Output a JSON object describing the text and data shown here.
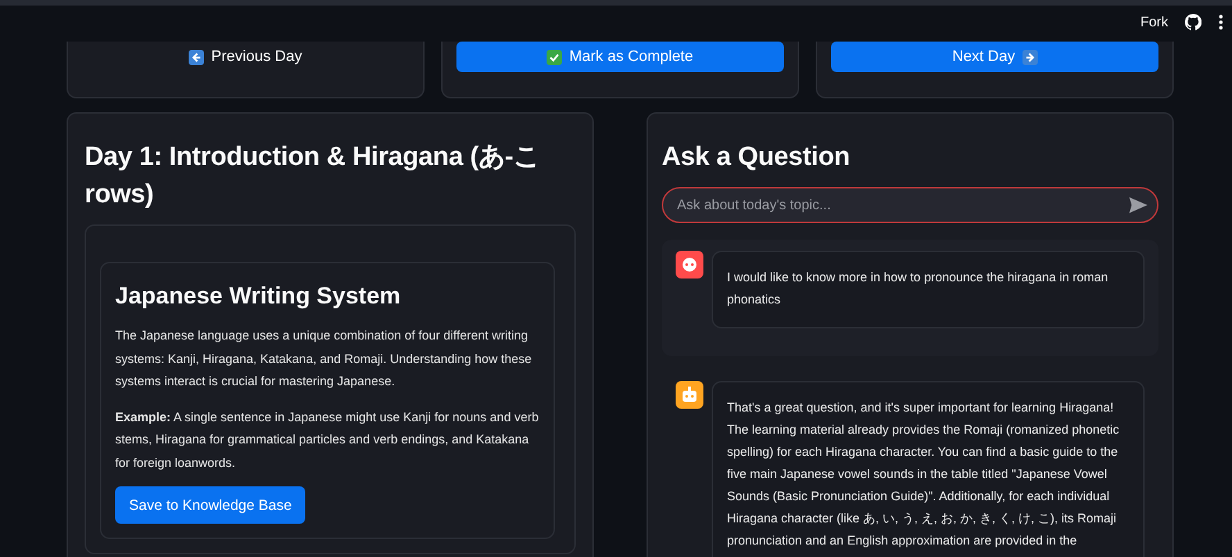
{
  "header": {
    "fork_label": "Fork"
  },
  "nav_buttons": [
    {
      "label": "Previous Day",
      "kind": "back",
      "primary": false
    },
    {
      "label": "Mark as Complete",
      "kind": "check",
      "primary": true
    },
    {
      "label": "Next Day",
      "kind": "forward",
      "primary": true
    }
  ],
  "lesson": {
    "title": "Day 1: Introduction & Hiragana (あ-こ rows)",
    "section": {
      "heading": "Japanese Writing System",
      "paragraphs": [
        "The Japanese language uses a unique combination of four different writing systems: Kanji, Hiragana, Katakana, and Romaji. Understanding how these systems interact is crucial for mastering Japanese.",
        "**Example:** A single sentence in Japanese might use Kanji for nouns and verb stems, Hiragana for grammatical particles and verb endings, and Katakana for foreign loanwords."
      ],
      "button": "Save to Knowledge Base"
    }
  },
  "chat": {
    "title": "Ask a Question",
    "input": {
      "placeholder": "Ask about today's topic..."
    },
    "messages": [
      {
        "kind": "user",
        "color": "#ff4b4b",
        "text": "I would like to know more in how to pronounce the hiragana in roman phonatics"
      },
      {
        "kind": "assistant",
        "color": "#ffa421",
        "text": "That's a great question, and it's super important for learning Hiragana! The learning material already provides the Romaji (romanized phonetic spelling) for each Hiragana character. You can find a basic guide to the five main Japanese vowel sounds in the table titled \"Japanese Vowel Sounds (Basic Pronunciation Guide)\". Additionally, for each individual Hiragana character (like あ, い, う, え, お, か, き, く, け, こ), its Romaji pronunciation and an English approximation are provided in the"
      }
    ]
  }
}
